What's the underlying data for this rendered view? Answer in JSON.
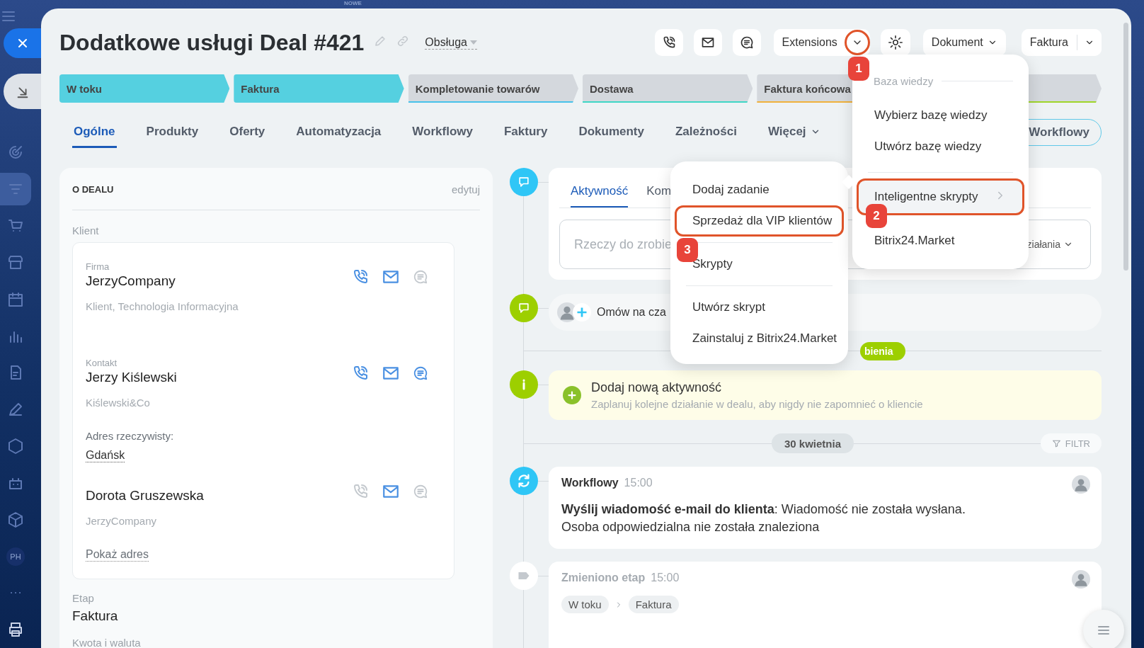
{
  "top_strip": {
    "label": "NOWE"
  },
  "sidebar": {
    "items": [
      {
        "kind": "target",
        "selected": false
      },
      {
        "kind": "funnel",
        "selected": true
      },
      {
        "kind": "cart",
        "selected": false
      },
      {
        "kind": "store",
        "selected": false
      },
      {
        "kind": "calendar",
        "selected": false
      },
      {
        "kind": "chart",
        "selected": false
      },
      {
        "kind": "doc",
        "selected": false
      },
      {
        "kind": "pen",
        "selected": false
      },
      {
        "kind": "hexagon",
        "selected": false
      },
      {
        "kind": "robot",
        "selected": false
      },
      {
        "kind": "box",
        "selected": false
      },
      {
        "kind": "avatar",
        "label": "PH",
        "selected": false
      },
      {
        "kind": "dots",
        "selected": false
      },
      {
        "kind": "printer",
        "selected": false
      }
    ]
  },
  "header": {
    "title": "Dodatkowe usługi Deal #421",
    "category": "Obsługa",
    "actions": [
      {
        "kind": "phone"
      },
      {
        "kind": "mail"
      },
      {
        "kind": "chat"
      }
    ],
    "extensions": {
      "label": "Extensions",
      "caret_framed": true
    },
    "document_button": "Dokument",
    "invoice_button": "Faktura"
  },
  "stages": [
    {
      "label": "W toku",
      "done": true,
      "color": "#55d0e0"
    },
    {
      "label": "Faktura",
      "done": true,
      "color": "#55d0e0"
    },
    {
      "label": "Kompletowanie towarów",
      "done": false,
      "color": "#47c2ea"
    },
    {
      "label": "Dostawa",
      "done": false,
      "color": "#3fd7c6"
    },
    {
      "label": "Faktura końcowa",
      "done": false,
      "color": "#f0b13c"
    },
    {
      "done": false,
      "color": "#9fd52a"
    }
  ],
  "tabs": [
    {
      "label": "Ogólne",
      "selected": true,
      "has_menu": false
    },
    {
      "label": "Produkty",
      "selected": false,
      "has_menu": false
    },
    {
      "label": "Oferty",
      "selected": false,
      "has_menu": false
    },
    {
      "label": "Automatyzacja",
      "selected": false,
      "has_menu": false
    },
    {
      "label": "Workflowy",
      "selected": false,
      "has_menu": false
    },
    {
      "label": "Faktury",
      "selected": false,
      "has_menu": false
    },
    {
      "label": "Dokumenty",
      "selected": false,
      "has_menu": false
    },
    {
      "label": "Zależności",
      "selected": false,
      "has_menu": false
    },
    {
      "label": "Więcej",
      "selected": false,
      "has_menu": true
    }
  ],
  "workflow_button": "Workflowy",
  "deal_card": {
    "title": "O DEALU",
    "edit": "edytuj",
    "client_label": "Klient",
    "contacts": [
      {
        "caption": "Firma",
        "name": "JerzyCompany",
        "detail": "Klient, Technologia Informacyjna",
        "phone_active": true,
        "mail_active": true,
        "chat_active": false
      },
      {
        "caption": "Kontakt",
        "name": "Jerzy Kiślewski",
        "detail": "Kiślewski&Co",
        "address_label": "Adres rzeczywisty:",
        "address": "Gdańsk",
        "phone_active": true,
        "mail_active": true,
        "chat_active": true
      },
      {
        "name": "Dorota Gruszewska",
        "detail": "JerzyCompany",
        "address_link": "Pokaż adres",
        "phone_active": false,
        "mail_active": true,
        "chat_active": false
      }
    ],
    "fields": [
      {
        "label": "Etap",
        "value": "Faktura"
      },
      {
        "label": "Kwota i waluta"
      }
    ]
  },
  "timeline": {
    "composer": {
      "tabs": [
        {
          "label": "Aktywność",
          "selected": true
        },
        {
          "label": "Kom",
          "selected": false
        }
      ],
      "placeholder": "Rzeczy do zrobie",
      "type_selector": "ziałania"
    },
    "chat": {
      "label": "Omów na cza"
    },
    "status_pill": "bienia",
    "new_activity": {
      "title": "Dodaj nową aktywność",
      "subtitle": "Zaplanuj kolejne działanie w dealu, aby nigdy nie zapomnieć o kliencie"
    },
    "date": "30 kwietnia",
    "filter": "FILTR",
    "events": [
      {
        "kind": "workflow",
        "title": "Workflowy",
        "time": "15:00",
        "text": "**Wyślij wiadomość e-mail do klienta**: Wiadomość nie została wysłana. Osoba odpowiedzialna nie została znaleziona"
      },
      {
        "kind": "stage",
        "title": "Zmieniono etap",
        "time": "15:00",
        "from": "W toku",
        "to": "Faktura"
      }
    ]
  },
  "extensions_menu": {
    "items": [
      {
        "kind": "header",
        "label": "Baza wiedzy"
      },
      {
        "kind": "item",
        "label": "Wybierz bazę wiedzy",
        "selected": false,
        "framed": false,
        "submenu": false
      },
      {
        "kind": "item",
        "label": "Utwórz bazę wiedzy",
        "selected": false,
        "framed": false,
        "submenu": false
      },
      {
        "kind": "divider"
      },
      {
        "kind": "item",
        "label": "Inteligentne skrypty",
        "selected": true,
        "framed": true,
        "submenu": true
      },
      {
        "kind": "item",
        "label": "Bitrix24.Market",
        "selected": false,
        "framed": false,
        "submenu": false
      }
    ]
  },
  "scripts_menu": {
    "items": [
      {
        "kind": "item",
        "label": "Dodaj zadanie",
        "selected": false,
        "framed": false,
        "submenu": false
      },
      {
        "kind": "item",
        "label": "Sprzedaż dla VIP klientów",
        "selected": false,
        "framed": true,
        "submenu": false
      },
      {
        "kind": "divider"
      },
      {
        "kind": "item",
        "label": "Skrypty",
        "selected": false,
        "framed": false,
        "submenu": false
      },
      {
        "kind": "divider"
      },
      {
        "kind": "item",
        "label": "Utwórz skrypt",
        "selected": false,
        "framed": false,
        "submenu": false
      },
      {
        "kind": "item",
        "label": "Zainstaluj z Bitrix24.Market",
        "selected": false,
        "framed": false,
        "submenu": false
      }
    ]
  },
  "callouts": [
    "1",
    "2",
    "3"
  ]
}
